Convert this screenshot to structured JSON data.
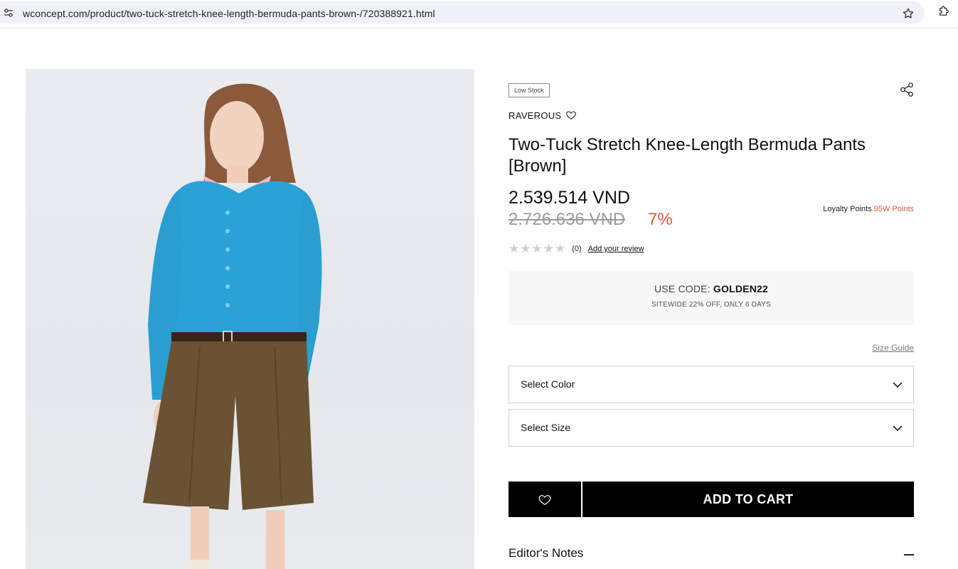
{
  "browser": {
    "url": "wconcept.com/product/two-tuck-stretch-knee-length-bermuda-pants-brown-/720388921.html",
    "icons": [
      "site-info-icon",
      "star-icon",
      "extensions-icon"
    ]
  },
  "product": {
    "image_alt": "Model wearing blue cardigan and brown Bermuda pants",
    "badge": "Low Stock",
    "brand": "RAVEROUS",
    "title": "Two-Tuck Stretch Knee-Length Bermuda Pants [Brown]",
    "price": "2.539.514 VND",
    "original_price": "2.726.636 VND",
    "discount": "7%",
    "loyalty_label": "Loyalty Points",
    "loyalty_points": "95W Points",
    "rating_stars": "★★★★★",
    "rating_value": 0,
    "review_count": "(0)",
    "add_review": "Add your review"
  },
  "promo": {
    "use_code_label": "USE CODE:",
    "code": "GOLDEN22",
    "subtext": "SITEWIDE 22% OFF, ONLY 6 DAYS"
  },
  "options": {
    "size_guide": "Size Guide",
    "color_placeholder": "Select Color",
    "size_placeholder": "Select Size"
  },
  "actions": {
    "add_to_cart": "ADD TO CART"
  },
  "sections": {
    "editors_notes": "Editor's Notes"
  },
  "colors": {
    "accent_red": "#e5533d",
    "button_black": "#000000"
  }
}
